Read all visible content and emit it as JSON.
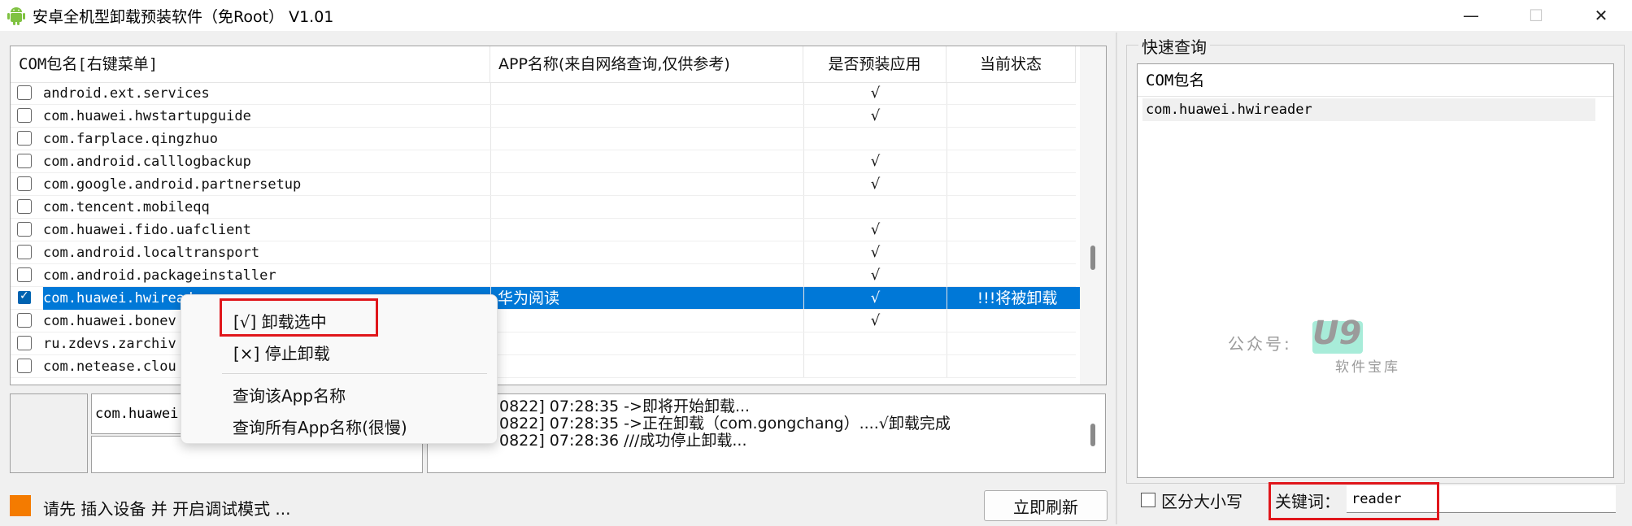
{
  "window": {
    "title": "安卓全机型卸载预装软件（免Root） V1.01",
    "minimize_glyph": "—",
    "maximize_glyph": "☐",
    "close_glyph": "✕"
  },
  "table": {
    "columns": [
      "COM包名[右键菜单]",
      "APP名称(来自网络查询,仅供参考)",
      "是否预装应用",
      "当前状态"
    ],
    "rows": [
      {
        "package": "android.ext.services",
        "app_name": "",
        "preinstalled": "√",
        "status": "",
        "checked": false
      },
      {
        "package": "com.huawei.hwstartupguide",
        "app_name": "",
        "preinstalled": "√",
        "status": "",
        "checked": false
      },
      {
        "package": "com.farplace.qingzhuo",
        "app_name": "",
        "preinstalled": "",
        "status": "",
        "checked": false
      },
      {
        "package": "com.android.calllogbackup",
        "app_name": "",
        "preinstalled": "√",
        "status": "",
        "checked": false
      },
      {
        "package": "com.google.android.partnersetup",
        "app_name": "",
        "preinstalled": "√",
        "status": "",
        "checked": false
      },
      {
        "package": "com.tencent.mobileqq",
        "app_name": "",
        "preinstalled": "",
        "status": "",
        "checked": false
      },
      {
        "package": "com.huawei.fido.uafclient",
        "app_name": "",
        "preinstalled": "√",
        "status": "",
        "checked": false
      },
      {
        "package": "com.android.localtransport",
        "app_name": "",
        "preinstalled": "√",
        "status": "",
        "checked": false
      },
      {
        "package": "com.android.packageinstaller",
        "app_name": "",
        "preinstalled": "√",
        "status": "",
        "checked": false
      },
      {
        "package": "com.huawei.hwireader",
        "app_name": "华为阅读",
        "preinstalled": "√",
        "status": "!!!将被卸载",
        "checked": true
      },
      {
        "package": "com.huawei.bonev",
        "app_name": "",
        "preinstalled": "√",
        "status": "",
        "checked": false
      },
      {
        "package": "ru.zdevs.zarchiv",
        "app_name": "",
        "preinstalled": "",
        "status": "",
        "checked": false
      },
      {
        "package": "com.netease.clou",
        "app_name": "",
        "preinstalled": "",
        "status": "",
        "checked": false
      }
    ]
  },
  "context_menu": {
    "items": [
      "[√] 卸载选中",
      "[×] 停止卸载",
      "查询该App名称",
      "查询所有App名称(很慢)"
    ]
  },
  "package_input": {
    "value": "com.huawei"
  },
  "log": {
    "lines": [
      "0822] 07:28:35 ->即将开始卸载...",
      "0822] 07:28:35 ->正在卸载（com.gongchang）....√卸载完成",
      "0822] 07:28:36 ///成功停止卸载..."
    ]
  },
  "status": {
    "text": "请先 插入设备 并 开启调试模式 ...",
    "indicator_color": "#f47b00"
  },
  "refresh_button": {
    "label": "立即刷新"
  },
  "quick_search": {
    "group_title": "快速查询",
    "column": "COM包名",
    "results": [
      "com.huawei.hwireader"
    ],
    "case_sensitive_label": "区分大小写",
    "keyword_label": "关键词：",
    "keyword_value": "reader"
  },
  "watermark": {
    "label": "公众号:",
    "logo": "U9",
    "sub": "软件宝库"
  },
  "colors": {
    "selection": "#0078d7",
    "highlight_box": "#e0161b"
  }
}
